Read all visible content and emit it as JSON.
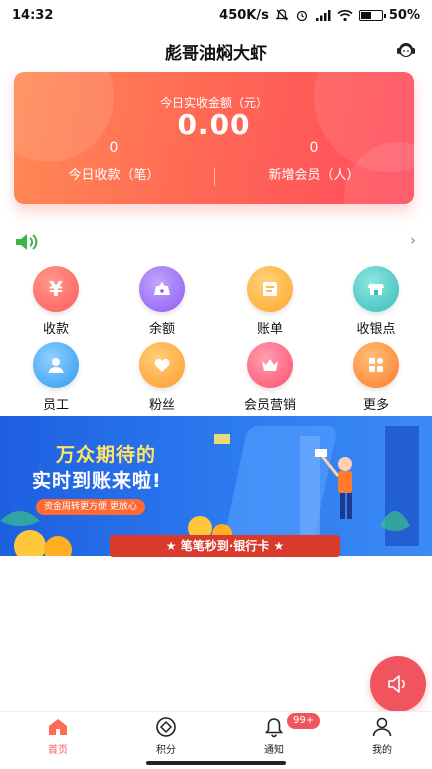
{
  "status_bar": {
    "time": "14:32",
    "network_speed": "450K/s",
    "battery_text": "50%",
    "battery_level": 0.5
  },
  "header": {
    "title": "彪哥油焖大虾",
    "service_icon": "customer-service-icon"
  },
  "summary": {
    "today_label": "今日实收金额（元）",
    "today_amount": "0.00",
    "collections_value": "0",
    "collections_label": "今日收款（笔）",
    "new_members_value": "0",
    "new_members_label": "新增会员（人）"
  },
  "notice": {
    "icon": "speaker-icon",
    "arrow": "›"
  },
  "grid": [
    {
      "label": "收款",
      "icon": "yen-icon",
      "color": "#ff6b6b"
    },
    {
      "label": "余额",
      "icon": "wallet-icon",
      "color": "#9b6cf0"
    },
    {
      "label": "账单",
      "icon": "bill-icon",
      "color": "#ffb545"
    },
    {
      "label": "收银点",
      "icon": "store-icon",
      "color": "#3cc7c3"
    },
    {
      "label": "员工",
      "icon": "person-icon",
      "color": "#2fa5f0"
    },
    {
      "label": "粉丝",
      "icon": "heart-icon",
      "color": "#ffa63a"
    },
    {
      "label": "会员营销",
      "icon": "crown-icon",
      "color": "#ff5c77"
    },
    {
      "label": "更多",
      "icon": "more-grid-icon",
      "color": "#ff8a3a"
    }
  ],
  "banner": {
    "title_line1": "万众期待的",
    "title_line2": "实时到账来啦!",
    "subtitle": "资金周转更方便 更放心",
    "ribbon": "★ 笔笔秒到·银行卡 ★"
  },
  "tabs": [
    {
      "label": "首页",
      "icon": "home-icon",
      "active": true
    },
    {
      "label": "积分",
      "icon": "points-icon",
      "active": false
    },
    {
      "label": "通知",
      "icon": "bell-icon",
      "active": false
    },
    {
      "label": "我的",
      "icon": "user-icon",
      "active": false
    }
  ],
  "notification_badge": "99+",
  "colors": {
    "accent": "#ff5a5a",
    "card_start": "#ff8a55",
    "card_end": "#ff4a5c",
    "banner_blue": "#2d7bf0"
  }
}
